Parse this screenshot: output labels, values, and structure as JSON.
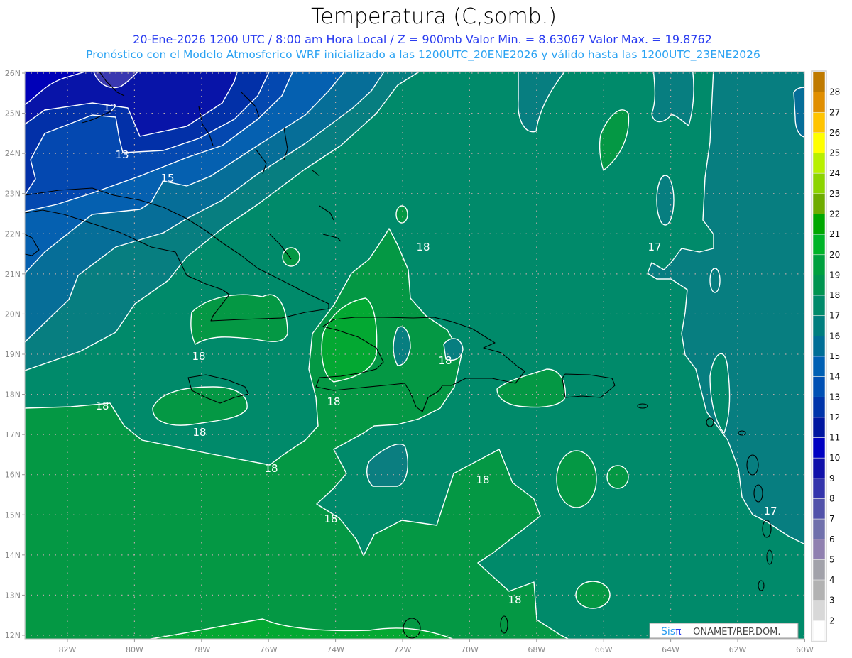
{
  "header": {
    "title": "Temperatura (C,somb.)",
    "line1": "20-Ene-2026  1200 UTC / 8:00 am Hora Local / Z = 900mb    Valor Min. = 8.63067  Valor Max. = 19.8762",
    "line2": "Pronóstico con el Modelo Atmosferico WRF inicializado a las 1200UTC_20ENE2026 y válido hasta las  1200UTC_23ENE2026"
  },
  "map": {
    "lat_labels": [
      "26N",
      "25N",
      "24N",
      "23N",
      "22N",
      "21N",
      "20N",
      "19N",
      "18N",
      "17N",
      "16N",
      "15N",
      "14N",
      "13N",
      "12N"
    ],
    "lon_labels": [
      "82W",
      "80W",
      "78W",
      "76W",
      "74W",
      "72W",
      "70W",
      "68W",
      "66W",
      "64W",
      "62W",
      "60W"
    ],
    "contour_labels": [
      "12",
      "13",
      "15",
      "18",
      "17",
      "18",
      "18",
      "18",
      "18",
      "18",
      "18",
      "18",
      "17",
      "18",
      "18"
    ],
    "fill_colors": {
      "c18_19": "#049844",
      "c19_20": "#03a832",
      "c17_18": "#008a6a",
      "c16_17": "#077e80",
      "c15_16": "#066e98",
      "c14_15": "#0560b0",
      "c13_14": "#0448b0",
      "c12_13": "#0230a8",
      "c11_12": "#0814a8",
      "c10_11": "#0000b8",
      "c9_10": "#3a38b0"
    }
  },
  "colorbar": {
    "labels": [
      "28",
      "27",
      "26",
      "25",
      "24",
      "23",
      "22",
      "21",
      "20",
      "19",
      "18",
      "17",
      "16",
      "15",
      "14",
      "13",
      "12",
      "11",
      "10",
      "9",
      "8",
      "7",
      "6",
      "5",
      "4",
      "3",
      "2"
    ],
    "colors": [
      "#bf7a00",
      "#e08e00",
      "#ffc400",
      "#ffff00",
      "#b8f000",
      "#8cd400",
      "#6eac00",
      "#00a800",
      "#00b428",
      "#00a03e",
      "#009450",
      "#008a6a",
      "#007e7e",
      "#006e96",
      "#0060b4",
      "#0050b4",
      "#0034aa",
      "#0016a0",
      "#0000c2",
      "#1010aa",
      "#3434ac",
      "#5252aa",
      "#7070ac",
      "#9080b0",
      "#a2a2aa",
      "#b2b2b2",
      "#d8d8d8",
      "#ffffff"
    ]
  },
  "credit": {
    "sis": "Sis",
    "pi": "π",
    "text": "– ONAMET/REP.DOM."
  }
}
